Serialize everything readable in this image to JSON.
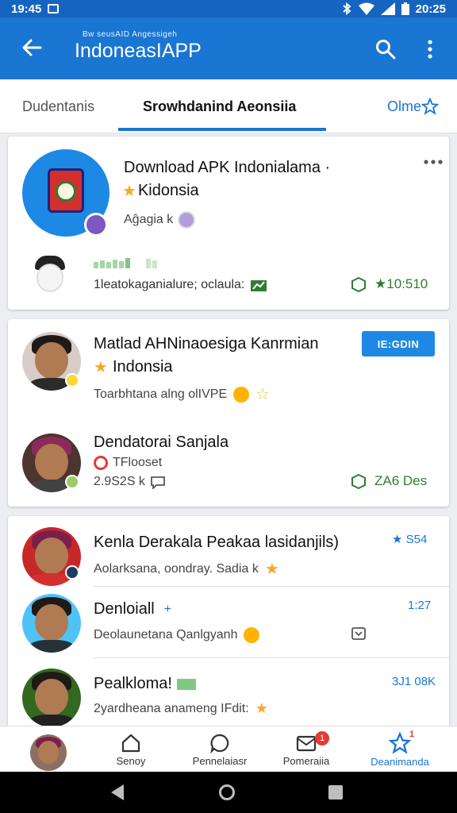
{
  "status_bar": {
    "time": "19:45",
    "clock_right": "20:25"
  },
  "app_bar": {
    "title_small": "Bw seusAID Angessigeh",
    "title": "IndoneasIAPP"
  },
  "tabs": [
    {
      "label": "Dudentanis"
    },
    {
      "label": "Srowhdanind Aeonsiia",
      "active": true
    },
    {
      "label": "Olme"
    }
  ],
  "card1": {
    "title": "Download APK Indonialama ·",
    "subtitle": "Kidonsia",
    "meta": "Aĝagia  k",
    "footer_text": "1leatokaganialure; oclaula:",
    "rating": "★10:510"
  },
  "card2": {
    "item1": {
      "title": "Matlad AHNinaoesiga Kanrmian",
      "subtitle": "Indonsia",
      "meta": "Toarbhtana alng olIVPE",
      "button": "IE:GDIN"
    },
    "item2": {
      "title": "Dendatorai Sanjala",
      "subtitle": "TFlooset",
      "meta": "2.9S2S  k",
      "right": "ZA6 Des"
    }
  },
  "card3": {
    "item1": {
      "title": "Kenla Derakala Peakaa lasidanjils)",
      "meta": "Aolarksana, oondray. Sadia  k",
      "right": "★  S54"
    },
    "item2": {
      "title": "Denloiall",
      "meta": "Deolaunetana Qanlgyanh",
      "right": "1:27"
    },
    "item3": {
      "title": "Pealkloma!",
      "meta": "2yardheana anameng IFdit:",
      "right": "3J1 08K"
    }
  },
  "bottom_nav": [
    {
      "label": "Senoy",
      "icon": "home-icon"
    },
    {
      "label": "Pennelaiasr",
      "icon": "chat-icon"
    },
    {
      "label": "Pomeraiia",
      "icon": "inbox-icon",
      "badge": "1"
    },
    {
      "label": "Deanimanda",
      "icon": "star-icon",
      "active": true,
      "badge": "1"
    }
  ],
  "colors": {
    "primary": "#1976d2",
    "accent_green": "#2e7d32",
    "star": "#f9a825"
  }
}
